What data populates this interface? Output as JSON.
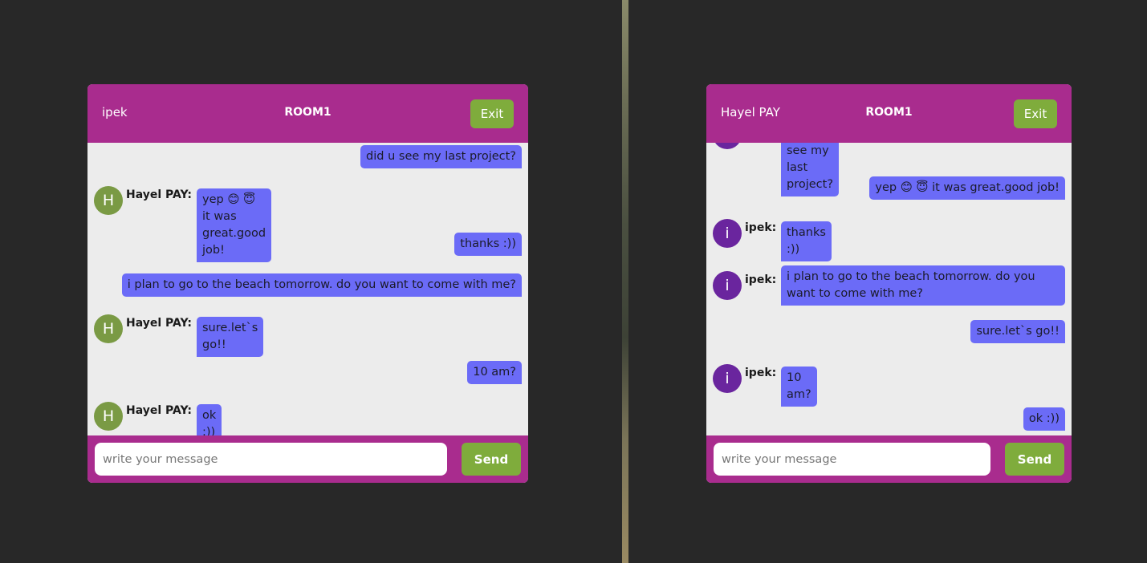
{
  "left_window": {
    "username": "ipek",
    "room": "ROOM1",
    "exit_label": "Exit",
    "messages": [
      "did u see my last project?",
      "yep 😊 😇 it was great.good job!",
      "thanks :))",
      "i plan to go to the beach tomorrow. do you want to come with me?",
      "sure.let`s go!!",
      "10 am?",
      "ok :))"
    ],
    "other_sender": "Hayel PAY:",
    "other_avatar": "H",
    "input_placeholder": "write your message",
    "send_label": "Send"
  },
  "right_window": {
    "username": "Hayel PAY",
    "room": "ROOM1",
    "exit_label": "Exit",
    "messages": [
      "did u see my last project?",
      "yep 😊 😇 it was great.good job!",
      "thanks :))",
      "i plan to go to the beach tomorrow. do you want to come with me?",
      "sure.let`s go!!",
      "10 am?",
      "ok :))"
    ],
    "other_sender": "ipek:",
    "other_avatar": "i",
    "input_placeholder": "write your message",
    "send_label": "Send"
  },
  "colors": {
    "header": "#a92c8e",
    "button": "#7fac3c",
    "bubble": "#6b6bf7",
    "avatar_hayel": "#7a9a44",
    "avatar_ipek": "#6a259e"
  }
}
